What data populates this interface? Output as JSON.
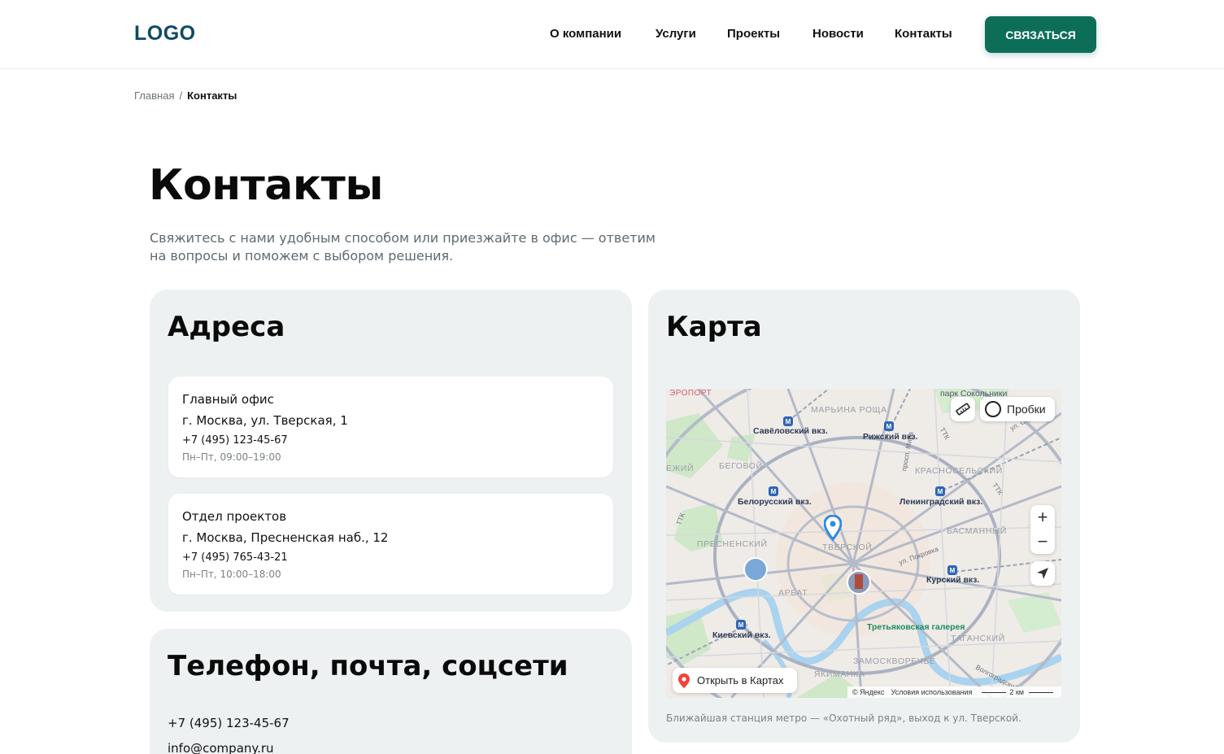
{
  "header": {
    "logo": "LOGO",
    "nav": [
      "О компании",
      "Услуги",
      "Проекты",
      "Новости",
      "Контакты"
    ],
    "cta_label": "СВЯЗАТЬСЯ"
  },
  "breadcrumb": {
    "home": "Главная",
    "separator": "/",
    "current": "Контакты"
  },
  "page": {
    "title": "Контакты",
    "subtitle": "Свяжитесь с нами удобным способом или приезжайте в офис — ответим на вопросы и поможем с выбором решения."
  },
  "addresses": {
    "title": "Адреса",
    "items": [
      {
        "name": "Главный офис",
        "street": "г. Москва, ул. Тверская, 1",
        "phone": "+7 (495) 123-45-67",
        "hours": "Пн–Пт, 09:00–19:00"
      },
      {
        "name": "Отдел проектов",
        "street": "г. Москва, Пресненская наб., 12",
        "phone": "+7 (495) 765-43-21",
        "hours": "Пн–Пт, 10:00–18:00"
      }
    ]
  },
  "contacts": {
    "title": "Телефон, почта, соцсети",
    "phone": "+7 (495) 123-45-67",
    "email": "info@company.ru"
  },
  "map": {
    "title": "Карта",
    "traffic_label": "Пробки",
    "zoom_in": "+",
    "zoom_out": "−",
    "open_label": "Открыть в Картах",
    "copyright": "© Яндекс",
    "terms": "Условия использования",
    "scale": "2 км",
    "labels": {
      "airport": "ЭРОПОРТ",
      "park": "парк Сокольники",
      "maryina_roshcha": "МАРЬИНА РОЩА",
      "savelovsky": "Савёловский вкз.",
      "rizhsky": "Рижский вкз.",
      "begovoy": "БЕГОВОЙ",
      "krasnoselsky": "КРАСНОСЕЛЬСКИЙ",
      "khoroshevsky_fragment": "ЕЖИЙ",
      "belorussky": "Белорусский вкз.",
      "leningradsky": "Ленинградский вкз.",
      "presnensky": "ПРЕСНЕНСКИЙ",
      "tverskoy": "ТВЕРСКОЙ",
      "basmanny": "БАСМАННЫЙ",
      "arbat": "АРБАТ",
      "kursky": "Курский вкз.",
      "kievsky": "Киевский вкз.",
      "tretyakov": "Третьяковская галерея",
      "tagansky": "ТАГАНСКИЙ",
      "zamoskvorechye": "ЗАМОСКВОРЕЧЬЕ",
      "yakimanka": "ЯКИМАНКА",
      "prospekt_mira": "просп. Мира",
      "ul_pokrovka": "ул. Покровка",
      "ul_stromynka": "ул. Стромынка",
      "volgogradsky": "Волгоградский",
      "ttk": "ТТК"
    },
    "note": "Ближайшая станция метро — «Охотный ряд», выход к ул. Тверской."
  },
  "colors": {
    "brand_dark": "#0d4a63",
    "accent": "#0d6e58",
    "card_bg": "#eef1f2",
    "map_pin": "#2f8be0"
  },
  "icons": {
    "ruler": "ruler-icon",
    "traffic": "traffic-ring-icon",
    "locate": "navigation-arrow-icon",
    "map_pin": "location-pin-icon",
    "open_pin": "red-pin-icon",
    "metro": "metro-station-icon"
  }
}
